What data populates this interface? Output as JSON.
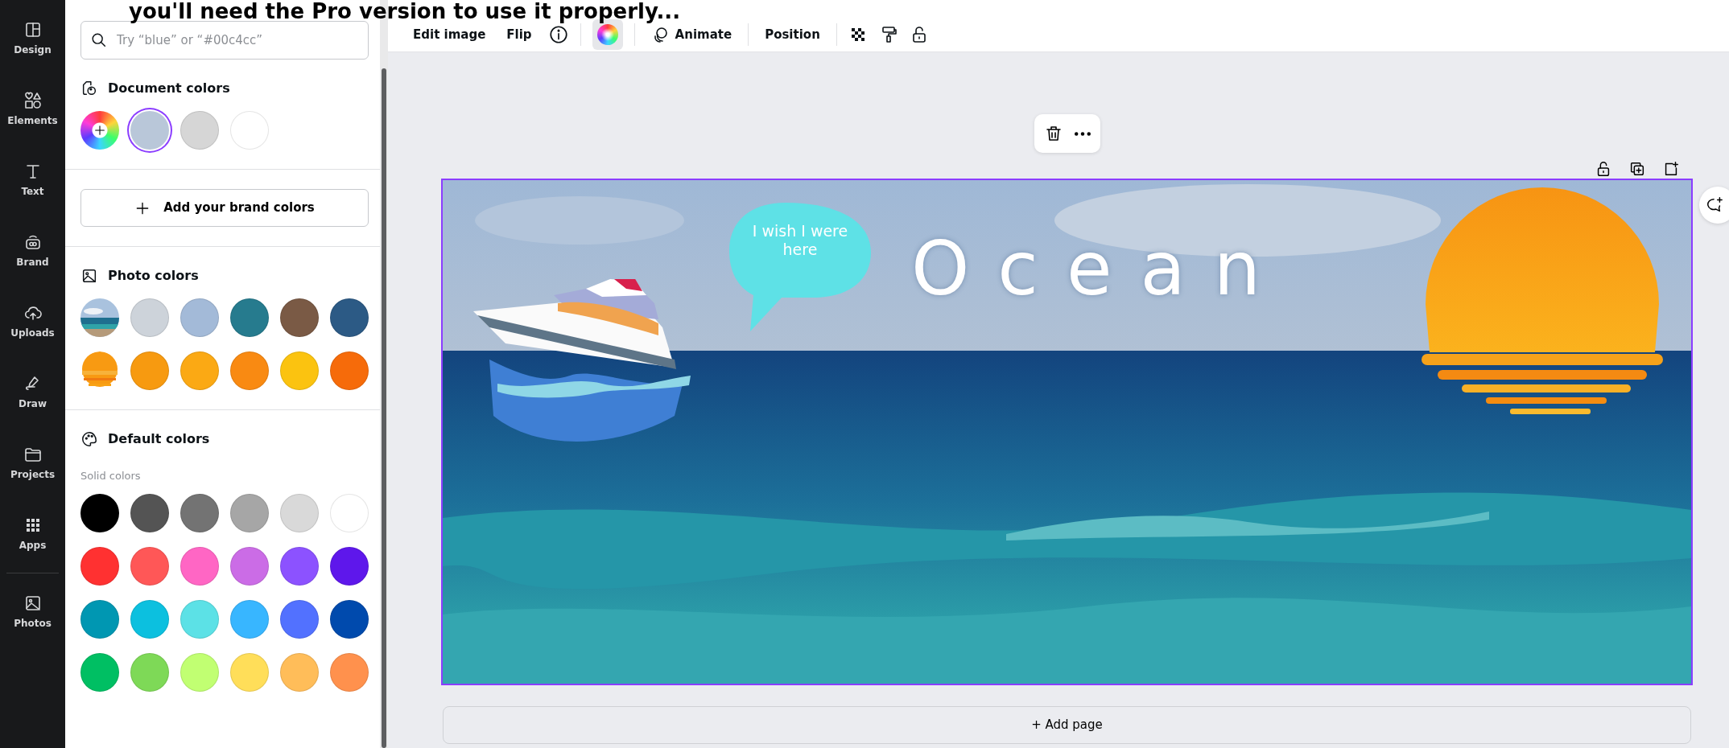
{
  "caption": "you'll need the Pro version to use it properly...",
  "rail": [
    {
      "label": "Design"
    },
    {
      "label": "Elements"
    },
    {
      "label": "Text"
    },
    {
      "label": "Brand"
    },
    {
      "label": "Uploads"
    },
    {
      "label": "Draw"
    },
    {
      "label": "Projects"
    },
    {
      "label": "Apps"
    },
    {
      "label": "Photos"
    }
  ],
  "search": {
    "placeholder": "Try “blue” or “#00c4cc”"
  },
  "document_colors": {
    "title": "Document colors",
    "swatches": [
      {
        "kind": "add",
        "selected": false
      },
      {
        "kind": "color",
        "color": "#b9c7d9",
        "selected": true
      },
      {
        "kind": "color",
        "color": "#d6d6d6",
        "selected": false
      },
      {
        "kind": "color",
        "color": "#ffffff",
        "selected": false
      }
    ]
  },
  "brand_button": {
    "label": "Add your brand colors"
  },
  "photo_colors": {
    "title": "Photo colors",
    "swatches": [
      {
        "kind": "picture"
      },
      {
        "kind": "color",
        "color": "#cdd3da"
      },
      {
        "kind": "color",
        "color": "#a3bad8"
      },
      {
        "kind": "color",
        "color": "#267b8e"
      },
      {
        "kind": "color",
        "color": "#7a5a45"
      },
      {
        "kind": "color",
        "color": "#2c5a85"
      },
      {
        "kind": "picture"
      },
      {
        "kind": "color",
        "color": "#f79a10"
      },
      {
        "kind": "color",
        "color": "#fba914"
      },
      {
        "kind": "color",
        "color": "#f98a12"
      },
      {
        "kind": "color",
        "color": "#fbc310"
      },
      {
        "kind": "color",
        "color": "#f66b0a"
      }
    ]
  },
  "default_colors": {
    "title": "Default colors",
    "subtitle": "Solid colors",
    "swatches": [
      {
        "color": "#000000"
      },
      {
        "color": "#545454"
      },
      {
        "color": "#737373"
      },
      {
        "color": "#a6a6a6"
      },
      {
        "color": "#d9d9d9"
      },
      {
        "color": "#ffffff"
      },
      {
        "color": "#ff3131"
      },
      {
        "color": "#ff5757"
      },
      {
        "color": "#ff66c4"
      },
      {
        "color": "#cb6ce6"
      },
      {
        "color": "#8c52ff"
      },
      {
        "color": "#5e17eb"
      },
      {
        "color": "#0097b2"
      },
      {
        "color": "#0cc0df"
      },
      {
        "color": "#5ce1e6"
      },
      {
        "color": "#38b6ff"
      },
      {
        "color": "#5271ff"
      },
      {
        "color": "#004aad"
      },
      {
        "color": "#00bf63"
      },
      {
        "color": "#7ed957"
      },
      {
        "color": "#c1ff72"
      },
      {
        "color": "#ffde59"
      },
      {
        "color": "#ffbd59"
      },
      {
        "color": "#ff914d"
      }
    ]
  },
  "toolbar": [
    {
      "kind": "text",
      "label": "Edit image"
    },
    {
      "kind": "text",
      "label": "Flip"
    },
    {
      "kind": "info"
    },
    {
      "kind": "separator"
    },
    {
      "kind": "wheel",
      "selected": true
    },
    {
      "kind": "separator"
    },
    {
      "kind": "animate",
      "label": "Animate"
    },
    {
      "kind": "separator"
    },
    {
      "kind": "text",
      "label": "Position"
    },
    {
      "kind": "separator"
    },
    {
      "kind": "transparency"
    },
    {
      "kind": "roller"
    },
    {
      "kind": "lock"
    }
  ],
  "design": {
    "bubble_text": "I wish I were here",
    "heading": "Ocean"
  },
  "add_page": {
    "label": "+ Add page"
  }
}
